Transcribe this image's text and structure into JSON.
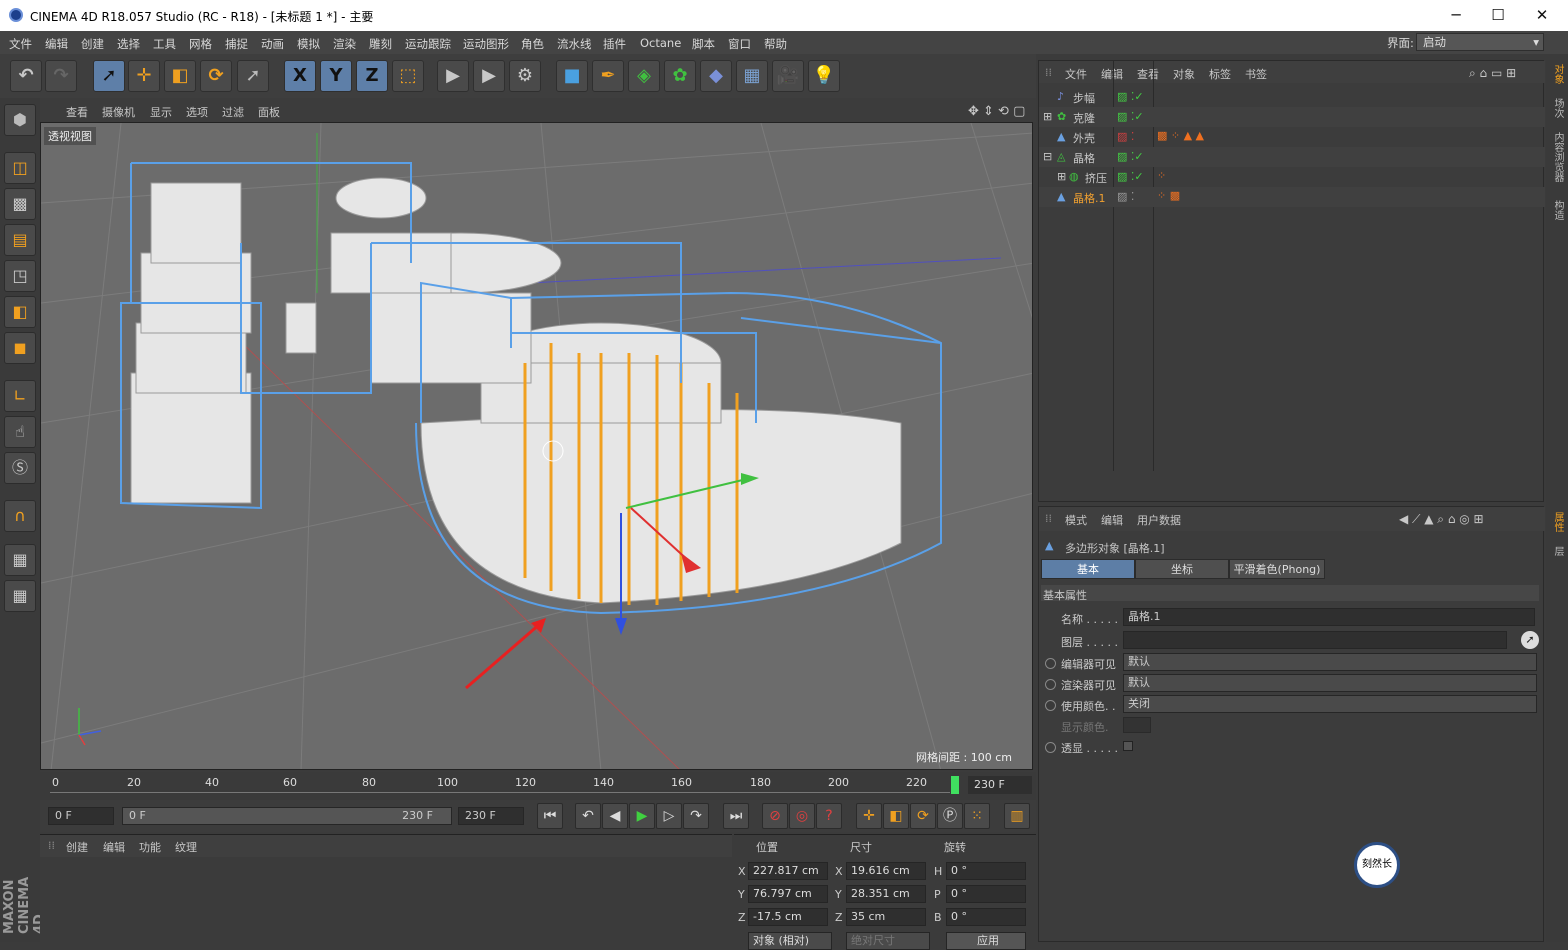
{
  "titlebar": {
    "title": "CINEMA 4D R18.057 Studio (RC - R18) - [未标题 1 *] - 主要",
    "min": "─",
    "max": "☐",
    "close": "✕"
  },
  "menu": [
    "文件",
    "编辑",
    "创建",
    "选择",
    "工具",
    "网格",
    "捕捉",
    "动画",
    "模拟",
    "渲染",
    "雕刻",
    "运动跟踪",
    "运动图形",
    "角色",
    "流水线",
    "插件",
    "Octane",
    "脚本",
    "窗口",
    "帮助"
  ],
  "interface": {
    "label": "界面:",
    "value": "启动"
  },
  "toolbar": {
    "x": "X",
    "y": "Y",
    "z": "Z"
  },
  "viewport": {
    "menu": [
      "查看",
      "摄像机",
      "显示",
      "选项",
      "过滤",
      "面板"
    ],
    "label": "透视视图",
    "grid_info": "网格间距 : 100 cm"
  },
  "timeline": {
    "ticks": [
      "0",
      "20",
      "40",
      "60",
      "80",
      "100",
      "120",
      "140",
      "160",
      "180",
      "200",
      "220"
    ],
    "end_frame": "230 F",
    "current": "0 F",
    "range_start": "0 F",
    "range_end": "230 F",
    "max_frame": "230 F"
  },
  "material": {
    "menu": [
      "创建",
      "编辑",
      "功能",
      "纹理"
    ]
  },
  "coords": {
    "headers": [
      "位置",
      "尺寸",
      "旋转"
    ],
    "rows": [
      {
        "axis": "X",
        "pos": "227.817 cm",
        "saxis": "X",
        "size": "19.616 cm",
        "raxis": "H",
        "rot": "0 °"
      },
      {
        "axis": "Y",
        "pos": "76.797 cm",
        "saxis": "Y",
        "size": "28.351 cm",
        "raxis": "P",
        "rot": "0 °"
      },
      {
        "axis": "Z",
        "pos": "-17.5 cm",
        "saxis": "Z",
        "size": "35 cm",
        "raxis": "B",
        "rot": "0 °"
      }
    ],
    "mode": "对象 (相对)",
    "size_mode": "绝对尺寸",
    "apply": "应用"
  },
  "objects": {
    "menu": [
      "文件",
      "编辑",
      "查看",
      "对象",
      "标签",
      "书签"
    ],
    "items": [
      {
        "name": "步幅",
        "color": "#c8c8c8"
      },
      {
        "name": "克隆",
        "color": "#c8c8c8"
      },
      {
        "name": "外壳",
        "color": "#c8c8c8"
      },
      {
        "name": "晶格",
        "color": "#c8c8c8"
      },
      {
        "name": "挤压",
        "color": "#c8c8c8"
      },
      {
        "name": "晶格.1",
        "color": "#f0a030"
      }
    ]
  },
  "attributes": {
    "menu": [
      "模式",
      "编辑",
      "用户数据"
    ],
    "object_title": "多边形对象 [晶格.1]",
    "tabs": [
      "基本",
      "坐标",
      "平滑着色(Phong)"
    ],
    "section": "基本属性",
    "fields": [
      {
        "label": "名称 . . . . .",
        "value": "晶格.1"
      },
      {
        "label": "图层 . . . . .",
        "value": ""
      },
      {
        "label": "编辑器可见",
        "value": "默认"
      },
      {
        "label": "渲染器可见",
        "value": "默认"
      },
      {
        "label": "使用颜色. .",
        "value": "关闭"
      },
      {
        "label": "显示颜色.",
        "value": ""
      },
      {
        "label": "透显 . . . . .",
        "value": ""
      }
    ]
  },
  "side_tabs": [
    "对象",
    "场次",
    "内容浏览器",
    "构造",
    "属性",
    "层"
  ],
  "brand": {
    "logo": "MAXON CINEMA 4D",
    "watermark": "刻然长"
  }
}
